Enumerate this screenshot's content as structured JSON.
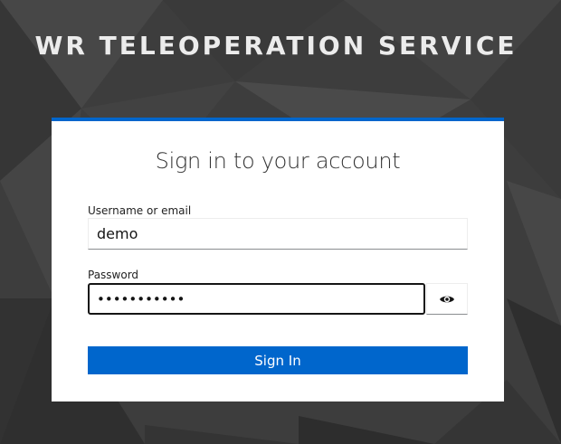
{
  "header": {
    "realm_title": "WR TELEOPERATION SERVICE"
  },
  "login": {
    "title": "Sign in to your account",
    "username_label": "Username or email",
    "username_value": "demo",
    "password_label": "Password",
    "password_value": "•••••••••••",
    "show_password_icon": "eye-icon",
    "submit_label": "Sign In"
  },
  "colors": {
    "accent": "#0066cc",
    "background": "#3b3b3b",
    "card": "#ffffff"
  }
}
